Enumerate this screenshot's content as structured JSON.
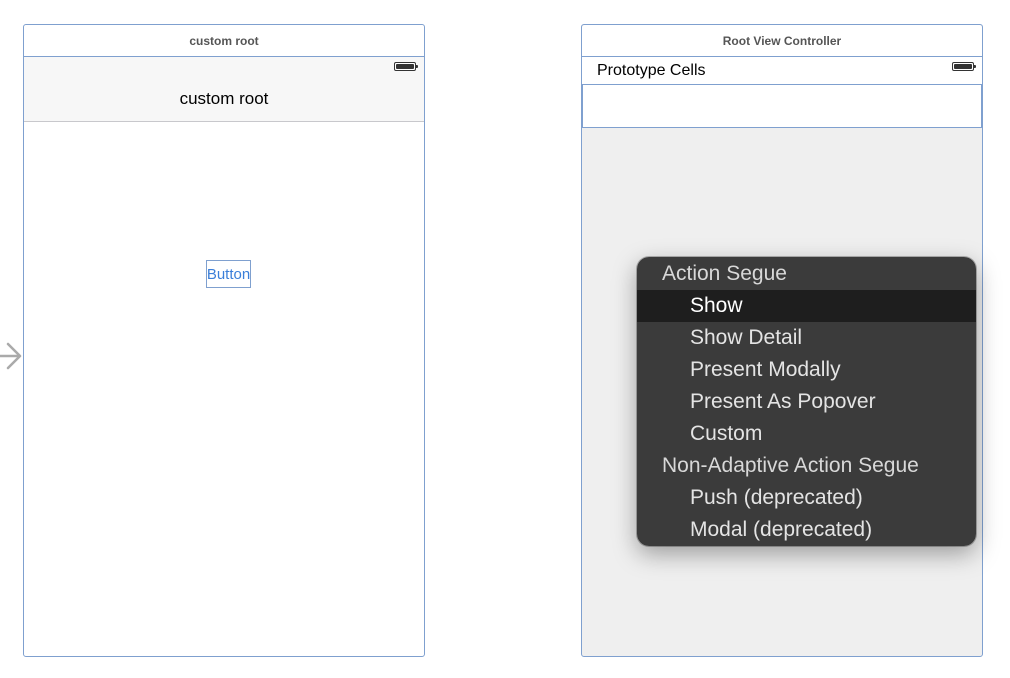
{
  "left_scene": {
    "header_title": "custom root",
    "navbar_title": "custom root",
    "button_label": "Button"
  },
  "right_scene": {
    "header_title": "Root View Controller",
    "prototype_label": "Prototype Cells"
  },
  "segue_menu": {
    "groups": [
      {
        "header": "Action Segue",
        "items": [
          "Show",
          "Show Detail",
          "Present Modally",
          "Present As Popover",
          "Custom"
        ]
      },
      {
        "header": "Non-Adaptive Action Segue",
        "items": [
          "Push (deprecated)",
          "Modal (deprecated)"
        ]
      }
    ],
    "selected_item": "Show"
  },
  "icons": {
    "battery": "battery-icon",
    "entry_arrow": "entry-point-arrow-icon"
  },
  "colors": {
    "scene_border": "#7fa0cf",
    "button_text": "#3b7fd9",
    "menu_background": "#373737",
    "menu_selected": "#1e1e1e"
  }
}
